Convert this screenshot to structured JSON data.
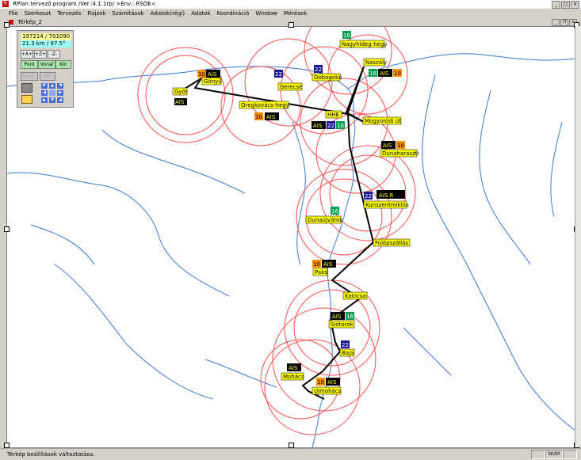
{
  "window": {
    "title": "RPlan tervező program  /Ver.:4.1.1rp/   >Env.: RSOE<",
    "app_icon": "R"
  },
  "menu": [
    "File",
    "Szerkeszt",
    "Tervezés",
    "Rajzok",
    "Számítások",
    "Adatok(régi)",
    "Adatok",
    "Koordináció",
    "Window",
    "Mérések"
  ],
  "child_window": {
    "title": "Térkép_2"
  },
  "panel": {
    "coords": "197214 / 701090",
    "scale": "21.3 km / 97.5°",
    "zoom_buttons": [
      "+A+",
      "+Z+",
      "-Z-"
    ],
    "mode_buttons": [
      "Pont",
      "Vonal",
      "Kör"
    ],
    "extra_buttons": [
      "Beáll.",
      "Info"
    ]
  },
  "status": {
    "message": "Térkép beállítások változtatása.",
    "num": "NUM"
  },
  "colors": {
    "label_bg": "#ffff00",
    "ais_bg": "#000000",
    "ais_fg": "#ffff00",
    "ch10": "#ff8c00",
    "ch16": "#00a050",
    "ch22": "#1a1a99",
    "circle": "#ff4d4d",
    "route": "#000000",
    "river": "#3a78d8"
  },
  "stations": [
    {
      "name": "Győr",
      "badges": [
        "AIS"
      ]
    },
    {
      "name": "Gönyű",
      "badges": [
        "10",
        "AIS"
      ]
    },
    {
      "name": "Öregkovács-hegy",
      "badges": [
        "10",
        "AIS"
      ]
    },
    {
      "name": "Gerecse",
      "badges": [
        "22"
      ]
    },
    {
      "name": "Dobogókő",
      "badges": [
        "22"
      ]
    },
    {
      "name": "Nagyhideg-hegy",
      "badges": [
        "16"
      ]
    },
    {
      "name": "Naszály",
      "badges": [
        "16",
        "AIS",
        "10"
      ]
    },
    {
      "name": "HHE",
      "badges": [
        "AIS",
        "22",
        "16"
      ]
    },
    {
      "name": "Mogyoródi út",
      "badges": []
    },
    {
      "name": "Dunaharaszti",
      "badges": [
        "AIS",
        "10"
      ]
    },
    {
      "name": "Kunszentmiklós",
      "badges": [
        "22",
        "AIS R"
      ]
    },
    {
      "name": "Dunaújváros",
      "badges": [
        "16"
      ]
    },
    {
      "name": "Fülöpszállás",
      "badges": []
    },
    {
      "name": "Paks",
      "badges": [
        "10",
        "AIS"
      ]
    },
    {
      "name": "Kalocsa",
      "badges": []
    },
    {
      "name": "Siótorok",
      "badges": [
        "AIS",
        "16"
      ]
    },
    {
      "name": "Baja",
      "badges": [
        "22"
      ]
    },
    {
      "name": "Mohács",
      "badges": [
        "AIS"
      ]
    },
    {
      "name": "Újmohács",
      "badges": [
        "10",
        "AIS"
      ]
    }
  ]
}
